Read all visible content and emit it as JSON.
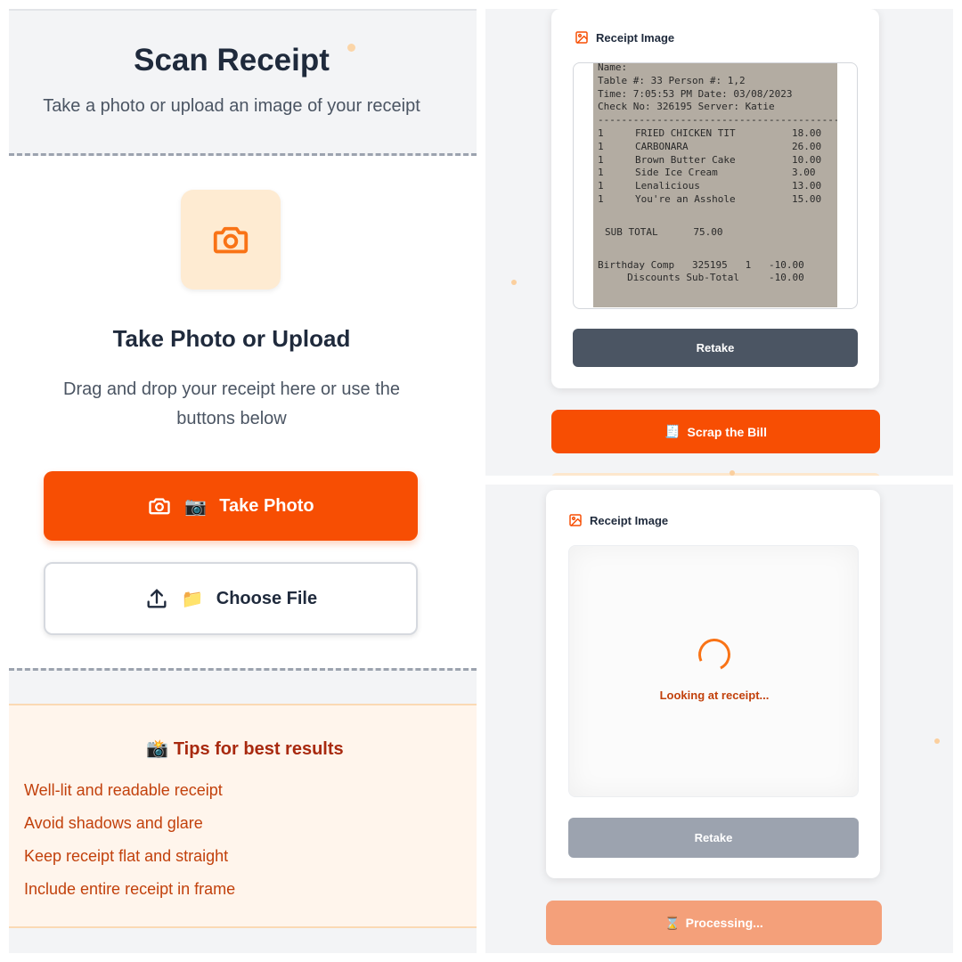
{
  "colors": {
    "accent": "#f74e03",
    "accent_light": "#feebd2",
    "text_dark": "#1f2a3c",
    "text_muted": "#4b5563",
    "tips_text": "#c2410c",
    "retake_dark": "#4b5563",
    "retake_disabled": "#9ca3af",
    "processing": "#f4a07a"
  },
  "scan_screen": {
    "title": "Scan Receipt",
    "subtitle": "Take a photo or upload an image of your receipt",
    "upload_icon": "camera-icon",
    "upload_title": "Take Photo or Upload",
    "upload_description": "Drag and drop your receipt here or use the buttons below",
    "take_photo": {
      "icon": "camera-icon",
      "emoji": "📷",
      "label": "Take Photo"
    },
    "choose_file": {
      "icon": "upload-icon",
      "emoji": "📁",
      "label": "Choose File"
    },
    "tips": {
      "emoji": "📸",
      "title": "Tips for best results",
      "items": [
        "Well-lit and readable receipt",
        "Avoid shadows and glare",
        "Keep receipt flat and straight",
        "Include entire receipt in frame"
      ]
    }
  },
  "preview_screen": {
    "card_title": "Receipt Image",
    "card_icon": "image-icon",
    "receipt_text": {
      "header": [
        "Name:",
        "Table #: 33 Person #: 1,2",
        "Time: 7:05:53 PM Date: 03/08/2023",
        "Check No: 326195 Server: Katie",
        "------------------------------------------"
      ],
      "items": [
        {
          "qty": "1",
          "name": "FRIED CHICKEN TIT",
          "price": "18.00"
        },
        {
          "qty": "1",
          "name": "CARBONARA",
          "price": "26.00"
        },
        {
          "qty": "1",
          "name": "Brown Butter Cake",
          "price": "10.00"
        },
        {
          "qty": "1",
          "name": "Side Ice Cream",
          "price": "3.00"
        },
        {
          "qty": "1",
          "name": "Lenalicious",
          "price": "13.00"
        },
        {
          "qty": "1",
          "name": "You're an Asshole",
          "price": "15.00"
        }
      ],
      "subtotal": "SUB TOTAL      75.00",
      "comp": "Birthday Comp   325195   1   -10.00",
      "discounts": "     Discounts Sub-Total     -10.00"
    },
    "retake_label": "Retake",
    "scrap_button": {
      "emoji": "🧾",
      "label": "Scrap the Bill"
    }
  },
  "processing_screen": {
    "card_title": "Receipt Image",
    "card_icon": "image-icon",
    "loading_text": "Looking at receipt...",
    "retake_label": "Retake",
    "processing_button": {
      "emoji": "⌛",
      "label": "Processing..."
    }
  }
}
